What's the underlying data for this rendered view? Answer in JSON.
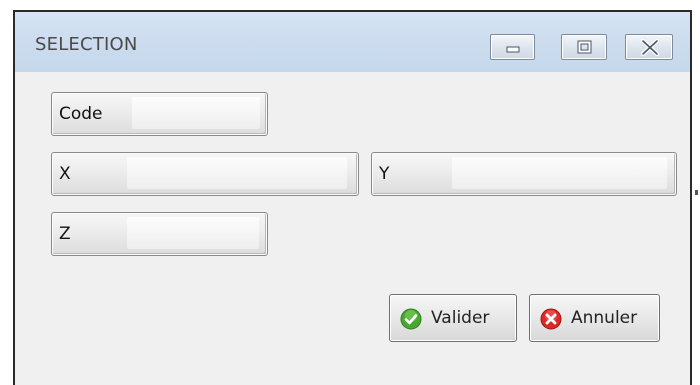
{
  "window": {
    "title": "SELECTION",
    "controls": {
      "minimize": "minimize",
      "maximize": "maximize",
      "close": "close"
    }
  },
  "form": {
    "fields": [
      {
        "label": "Code",
        "value": ""
      },
      {
        "label": "X",
        "value": ""
      },
      {
        "label": "Y",
        "value": ""
      },
      {
        "label": "Z",
        "value": ""
      }
    ]
  },
  "actions": {
    "validate_label": "Valider",
    "cancel_label": "Annuler"
  },
  "icons": {
    "validate": "check-icon",
    "cancel": "close-icon"
  },
  "colors": {
    "titlebar": "#ccdcee",
    "validate_icon": "#4aa832",
    "cancel_icon": "#d92a26"
  }
}
